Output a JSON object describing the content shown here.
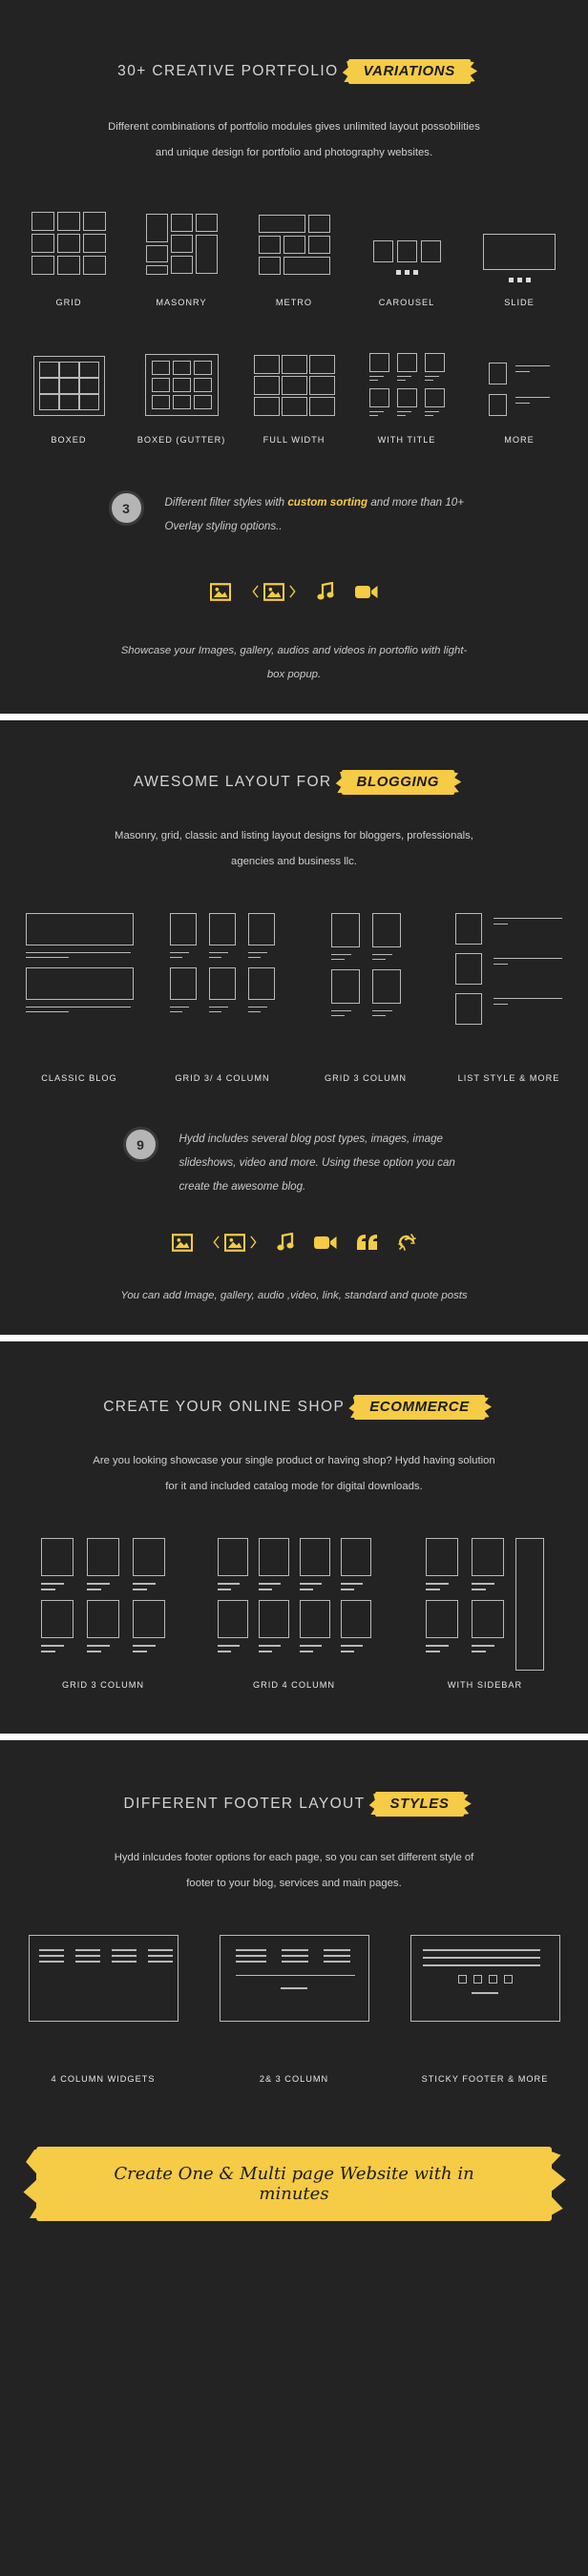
{
  "theme": {
    "bg": "#232323",
    "accent": "#f6cb45",
    "line": "#b9b9b9",
    "text": "#d4d4d4"
  },
  "sections": [
    {
      "id": "portfolio",
      "heading_plain": "30+ CREATIVE PORTFOLIO",
      "heading_brush": "VARIATIONS",
      "subtitle_line1": "Different combinations of portfolio modules gives unlimited layout possobilities",
      "subtitle_line2": "and unique design for portfolio and photography websites.",
      "cards_row1": [
        {
          "label": "GRID",
          "art": "grid-3x3"
        },
        {
          "label": "MASONRY",
          "art": "masonry"
        },
        {
          "label": "METRO",
          "art": "metro"
        },
        {
          "label": "CAROUSEL",
          "art": "carousel"
        },
        {
          "label": "SLIDE",
          "art": "slide"
        }
      ],
      "cards_row2": [
        {
          "label": "BOXED",
          "art": "boxed"
        },
        {
          "label": "BOXED (GUTTER)",
          "art": "boxed-gutter"
        },
        {
          "label": "FULL WIDTH",
          "art": "full-width"
        },
        {
          "label": "WITH TITLE",
          "art": "with-title"
        },
        {
          "label": "MORE",
          "art": "more"
        }
      ],
      "note_number": "3",
      "note_pre": "Different filter styles with ",
      "note_bold": "custom sorting",
      "note_post": " and more than 10+ Overlay styling options..",
      "media_icons": [
        "image-icon",
        "gallery-icon",
        "audio-icon",
        "video-icon"
      ],
      "caption_line1": "Showcase your Images, gallery, audios and videos in portoflio with light-",
      "caption_line2": "box popup."
    },
    {
      "id": "blogging",
      "heading_plain": "AWESOME LAYOUT FOR",
      "heading_brush": "BLOGGING",
      "subtitle_line1": "Masonry, grid, classic and listing layout designs for  bloggers, professionals,",
      "subtitle_line2": "agencies and business llc.",
      "cards_row1": [
        {
          "label": "CLASSIC BLOG",
          "art": "classic-blog"
        },
        {
          "label": "GRID 3/ 4 COLUMN",
          "art": "grid-3-4-col"
        },
        {
          "label": "GRID 3 COLUMN",
          "art": "grid-3-col"
        },
        {
          "label": "LIST STYLE & MORE",
          "art": "list-style"
        }
      ],
      "note_number": "9",
      "note_pre": "Hydd includes several blog post types, images, image slideshows, video and more. Using these option you can create the awesome blog.",
      "note_bold": "",
      "note_post": "",
      "media_icons": [
        "image-icon",
        "gallery-icon",
        "audio-icon",
        "video-icon",
        "quote-icon",
        "link-icon"
      ],
      "caption_line1": "You can add Image, gallery, audio ,video, link, standard and quote posts",
      "caption_line2": ""
    },
    {
      "id": "ecommerce",
      "heading_plain": "CREATE YOUR ONLINE SHOP",
      "heading_brush": "ECOMMERCE",
      "subtitle_line1": "Are you looking showcase your single product or having shop? Hydd having solution",
      "subtitle_line2": "for it and included catalog mode for digital downloads.",
      "cards_row1": [
        {
          "label": "GRID 3 COLUMN",
          "art": "shop-3-col"
        },
        {
          "label": "GRID 4 COLUMN",
          "art": "shop-4-col"
        },
        {
          "label": "WITH SIDEBAR",
          "art": "shop-sidebar"
        }
      ]
    },
    {
      "id": "footer-layout",
      "heading_plain": "DIFFERENT FOOTER LAYOUT",
      "heading_brush": "STYLES",
      "subtitle_line1": "Hydd inlcudes footer options for each page, so you can set different style of",
      "subtitle_line2": "footer to your blog, services and main pages.",
      "cards_row1": [
        {
          "label": "4 COLUMN WIDGETS",
          "art": "footer-4col"
        },
        {
          "label": "2& 3 COLUMN",
          "art": "footer-23col"
        },
        {
          "label": "STICKY FOOTER & MORE",
          "art": "footer-sticky"
        }
      ]
    }
  ],
  "final_ribbon": {
    "text": "Create One & Multi page Website with in minutes"
  }
}
